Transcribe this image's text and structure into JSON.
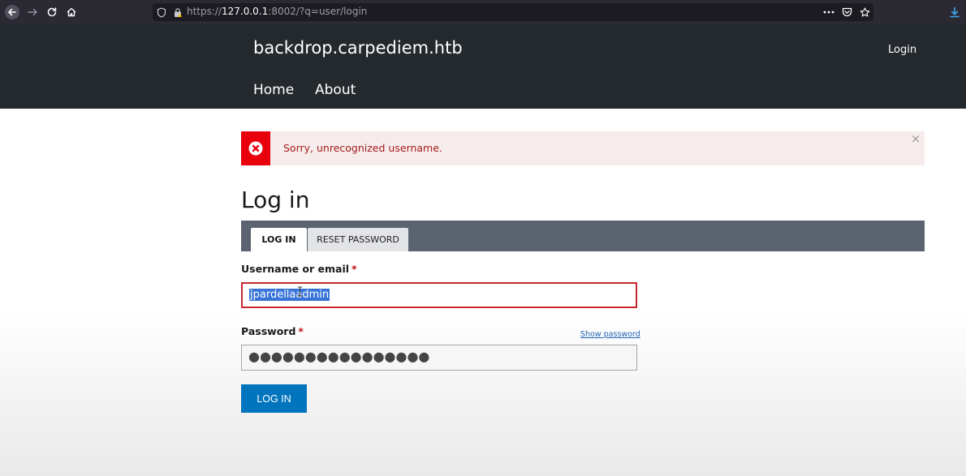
{
  "browser": {
    "url_prefix": "https://",
    "url_host": "127.0.0.1",
    "url_rest": ":8002/?q=user/login",
    "icons": [
      "back-icon",
      "forward-icon",
      "reload-icon",
      "home-icon",
      "shield-icon",
      "lock-icon",
      "more-icon",
      "pocket-icon",
      "bookmark-star-icon",
      "download-icon"
    ]
  },
  "header": {
    "site_name": "backdrop.carpediem.htb",
    "login_link": "Login",
    "nav": [
      {
        "label": "Home"
      },
      {
        "label": "About"
      }
    ]
  },
  "messages": {
    "error": "Sorry, unrecognized username.",
    "close_glyph": "×"
  },
  "page": {
    "title": "Log in"
  },
  "tabs": [
    {
      "label": "LOG IN",
      "active": true
    },
    {
      "label": "RESET PASSWORD",
      "active": false
    }
  ],
  "form": {
    "username": {
      "label": "Username or email",
      "required_mark": "*",
      "value": "jpardellaadmin"
    },
    "password": {
      "label": "Password",
      "required_mark": "*",
      "masked_value": "●●●●●●●●●●●●●●●●",
      "show_password": "Show password"
    },
    "submit_label": "LOG IN"
  },
  "colors": {
    "header_bg": "#24292e",
    "error_accent": "#e8000d",
    "error_bg": "#f7ecec",
    "tabs_bg": "#5b6270",
    "primary_button": "#0074bd",
    "invalid_border": "#c6272d"
  }
}
